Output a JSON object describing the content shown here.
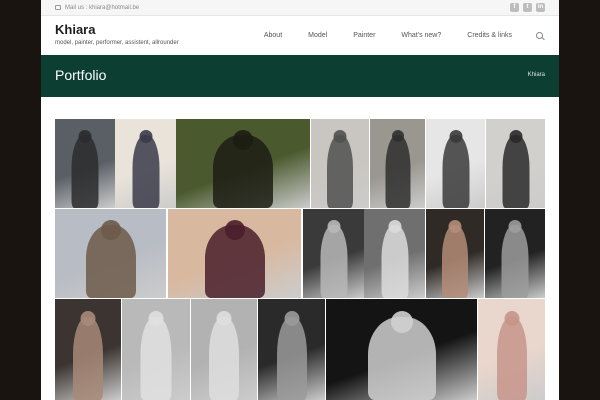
{
  "topbar": {
    "mail_text": "Mail us : khiara@hotmail.be",
    "socials": [
      "f",
      "t",
      "in"
    ]
  },
  "header": {
    "title": "Khiara",
    "tagline": "model, painter, performer, assistent, allrounder"
  },
  "nav": {
    "items": [
      "About",
      "Model",
      "Painter",
      "What's new?",
      "Credits & links"
    ]
  },
  "banner": {
    "title": "Portfolio",
    "breadcrumb": "Khiara"
  },
  "gallery": {
    "rows": [
      [
        {
          "tone": "#5a5f66",
          "figure": "#2b2b2d"
        },
        {
          "tone": "#e9e3da",
          "figure": "#3a3a4a"
        },
        {
          "tone": "#4a5a2e",
          "figure": "#1d1d14"
        },
        {
          "tone": "#c9c5c0",
          "figure": "#505050"
        },
        {
          "tone": "#9a9690",
          "figure": "#2f2f2f"
        },
        {
          "tone": "#e6e6e6",
          "figure": "#3a3a3a"
        },
        {
          "tone": "#d2d0cc",
          "figure": "#2a2a2a"
        }
      ],
      [
        {
          "tone": "#b8bcc4",
          "figure": "#6d5a4a"
        },
        {
          "tone": "#d8b9a0",
          "figure": "#4a1e2a"
        },
        {
          "tone": "#3a3a3a",
          "figure": "#b9b9b9"
        },
        {
          "tone": "#6f6f6f",
          "figure": "#dcdcdc"
        },
        {
          "tone": "#2f2a26",
          "figure": "#b48c78"
        },
        {
          "tone": "#222222",
          "figure": "#9c9c9c"
        }
      ],
      [
        {
          "tone": "#3b3430",
          "figure": "#a88a78"
        },
        {
          "tone": "#b9b9b9",
          "figure": "#e0e0e0"
        },
        {
          "tone": "#b2b2b2",
          "figure": "#dedede"
        },
        {
          "tone": "#2a2a2a",
          "figure": "#9a9a9a"
        },
        {
          "tone": "#141414",
          "figure": "#cfcfcf"
        },
        {
          "tone": "#e9d6cc",
          "figure": "#c7958a"
        }
      ]
    ]
  }
}
